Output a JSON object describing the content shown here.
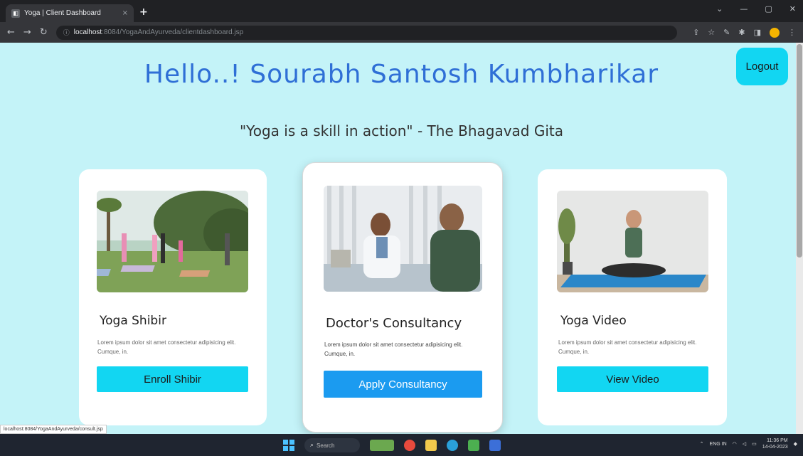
{
  "browser": {
    "tab_title": "Yoga | Client Dashboard",
    "tab_close": "×",
    "new_tab": "+",
    "url_host": "localhost",
    "url_rest": ":8084/YogaAndAyurveda/clientdashboard.jsp",
    "window_controls": [
      "⌄",
      "—",
      "▢",
      "✕"
    ]
  },
  "page": {
    "greeting": "Hello..!  Sourabh Santosh Kumbharikar",
    "logout_label": "Logout",
    "quote": "\"Yoga is a skill in action\" - The Bhagavad Gita",
    "cards": [
      {
        "title": "Yoga Shibir",
        "text": "Lorem ipsum dolor sit amet consectetur adipisicing elit. Cumque, in.",
        "button": "Enroll Shibir"
      },
      {
        "title": "Doctor's Consultancy",
        "text": "Lorem ipsum dolor sit amet consectetur adipisicing elit. Cumque, in.",
        "button": "Apply Consultancy"
      },
      {
        "title": "Yoga Video",
        "text": "Lorem ipsum dolor sit amet consectetur adipisicing elit. Cumque, in.",
        "button": "View Video"
      }
    ]
  },
  "status_bar_url": "localhost:8084/YogaAndAyurveda/consult.jsp",
  "taskbar": {
    "search_label": "Search",
    "language": "ENG\nIN",
    "time": "11:36 PM",
    "date": "14-04-2023"
  },
  "colors": {
    "page_bg": "#c4f3f8",
    "greeting": "#2f6fd6",
    "cyan_button": "#12d6f2",
    "blue_button": "#1b9bf0"
  }
}
